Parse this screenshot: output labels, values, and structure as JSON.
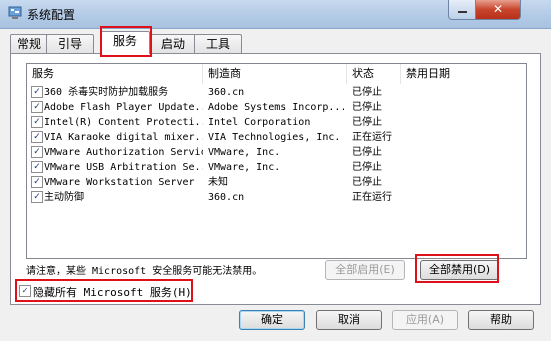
{
  "window": {
    "title": "系统配置",
    "close_glyph": "✕"
  },
  "tabs": [
    {
      "label": "常规"
    },
    {
      "label": "引导"
    },
    {
      "label": "服务"
    },
    {
      "label": "启动"
    },
    {
      "label": "工具"
    }
  ],
  "services": {
    "headers": {
      "service": "服务",
      "manufacturer": "制造商",
      "status": "状态",
      "disabled_date": "禁用日期"
    },
    "rows": [
      {
        "checked": true,
        "name": "360 杀毒实时防护加载服务",
        "manufacturer": "360.cn",
        "status": "已停止",
        "date": ""
      },
      {
        "checked": true,
        "name": "Adobe Flash Player Update...",
        "manufacturer": "Adobe Systems Incorp...",
        "status": "已停止",
        "date": ""
      },
      {
        "checked": true,
        "name": "Intel(R) Content Protecti...",
        "manufacturer": "Intel Corporation",
        "status": "已停止",
        "date": ""
      },
      {
        "checked": true,
        "name": "VIA Karaoke digital mixer...",
        "manufacturer": "VIA Technologies, Inc.",
        "status": "正在运行",
        "date": ""
      },
      {
        "checked": true,
        "name": "VMware Authorization Service",
        "manufacturer": "VMware, Inc.",
        "status": "已停止",
        "date": ""
      },
      {
        "checked": true,
        "name": "VMware USB Arbitration Se...",
        "manufacturer": "VMware, Inc.",
        "status": "已停止",
        "date": ""
      },
      {
        "checked": true,
        "name": "VMware Workstation Server",
        "manufacturer": "未知",
        "status": "已停止",
        "date": ""
      },
      {
        "checked": true,
        "name": "主动防御",
        "manufacturer": "360.cn",
        "status": "正在运行",
        "date": ""
      }
    ]
  },
  "notice": "请注意，某些 Microsoft 安全服务可能无法禁用。",
  "buttons": {
    "enable_all": "全部启用(E)",
    "disable_all": "全部禁用(D)",
    "ok": "确定",
    "cancel": "取消",
    "apply": "应用(A)",
    "help": "帮助"
  },
  "hide_microsoft": {
    "checked": true,
    "label": "隐藏所有 Microsoft 服务(H)"
  },
  "colors": {
    "highlight": "#e0101a",
    "check": "#1b3f7a"
  }
}
